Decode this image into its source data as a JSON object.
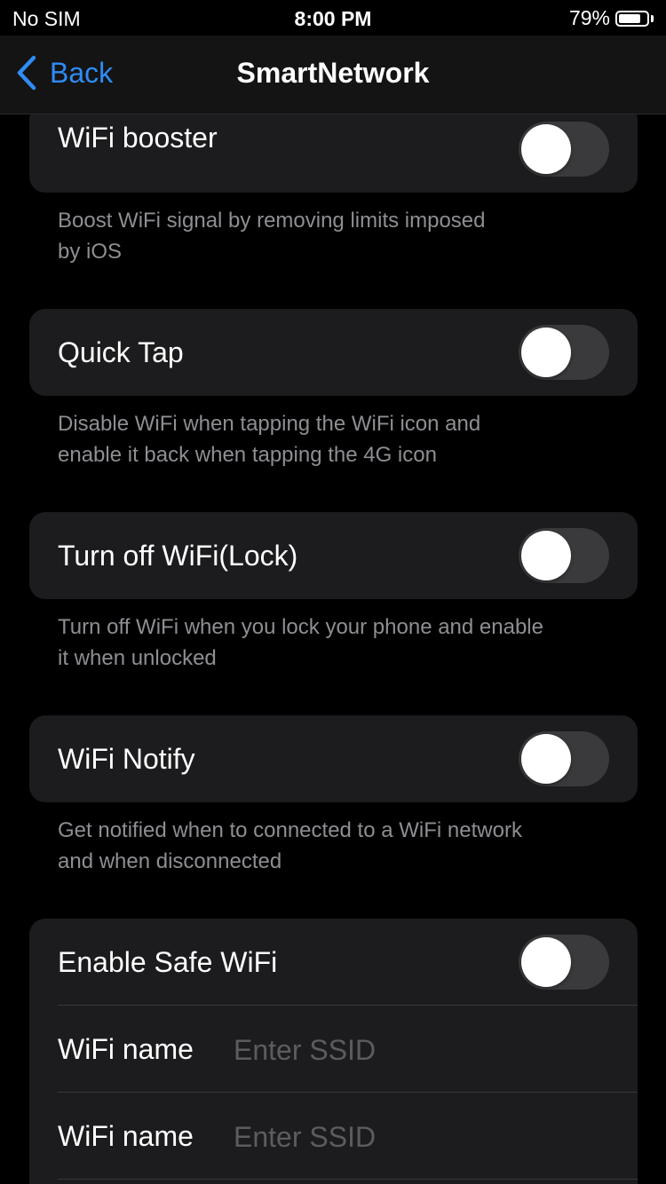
{
  "status_bar": {
    "carrier": "No SIM",
    "time": "8:00 PM",
    "battery_percent": "79%",
    "battery_level": 0.79
  },
  "nav": {
    "back_label": "Back",
    "title": "SmartNetwork"
  },
  "settings": [
    {
      "label": "WiFi booster",
      "enabled": false,
      "footer": [
        "Boost WiFi signal by removing limits imposed",
        "by iOS"
      ]
    },
    {
      "label": "Quick Tap",
      "enabled": false,
      "footer": [
        "Disable WiFi when tapping the WiFi icon and",
        "enable it back when tapping the 4G icon"
      ]
    },
    {
      "label": "Turn off WiFi(Lock)",
      "enabled": false,
      "footer": [
        "Turn off WiFi when you lock your phone and enable",
        "it when unlocked"
      ]
    },
    {
      "label": "WiFi Notify",
      "enabled": false,
      "footer": [
        "Get notified when to connected to a WiFi network",
        "and when disconnected"
      ]
    }
  ],
  "safe_wifi": {
    "label": "Enable Safe WiFi",
    "enabled": false,
    "fields": [
      {
        "label": "WiFi name",
        "placeholder": "Enter SSID",
        "value": ""
      },
      {
        "label": "WiFi name",
        "placeholder": "Enter SSID",
        "value": ""
      }
    ]
  },
  "colors": {
    "accent": "#2f8cf5",
    "background": "#000000",
    "card": "#1c1c1e",
    "toggle_off": "#3a3a3c",
    "secondary_text": "#8e8e93"
  }
}
